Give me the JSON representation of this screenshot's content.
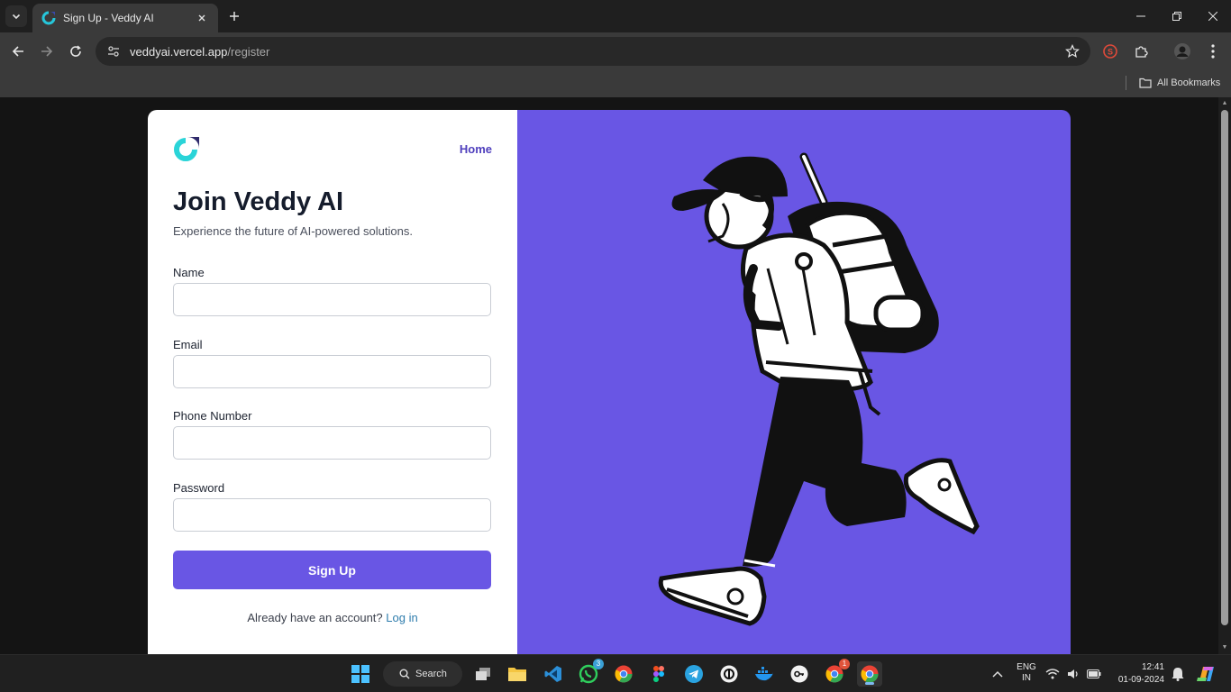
{
  "browser": {
    "tab_title": "Sign Up - Veddy AI",
    "url_host": "veddyai.vercel.app",
    "url_path": "/register",
    "bookmarks_label": "All Bookmarks"
  },
  "page": {
    "nav_home": "Home",
    "heading": "Join Veddy AI",
    "subheading": "Experience the future of AI-powered solutions.",
    "fields": [
      {
        "label": "Name",
        "value": ""
      },
      {
        "label": "Email",
        "value": ""
      },
      {
        "label": "Phone Number",
        "value": ""
      },
      {
        "label": "Password",
        "value": ""
      }
    ],
    "submit_label": "Sign Up",
    "login_prompt": "Already have an account?",
    "login_link": "Log in",
    "accent_color": "#6956e4",
    "illustration": "hiker-with-backpack-illustration"
  },
  "taskbar": {
    "search_label": "Search",
    "whatsapp_badge": "3",
    "chrome_badge": "1",
    "lang_line1": "ENG",
    "lang_line2": "IN",
    "time": "12:41",
    "date": "01-09-2024"
  }
}
